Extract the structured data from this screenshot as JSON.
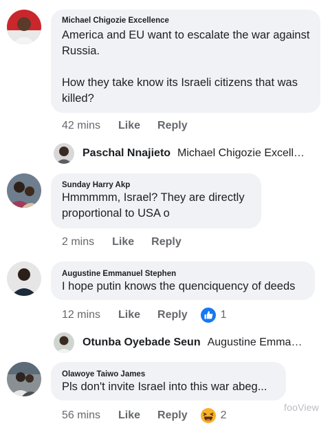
{
  "comments": [
    {
      "author": "Michael Chigozie Excellence",
      "text": "America and EU want to escalate the war against Russia.\n\nHow they take know its Israeli citizens that was killed?",
      "time": "42 mins",
      "like_label": "Like",
      "reply_label": "Reply",
      "reply": {
        "author": "Paschal Nnajieto",
        "preview": "Michael Chigozie Excellence"
      }
    },
    {
      "author": "Sunday Harry Akp",
      "text": "Hmmmmm, Israel? They are directly proportional to USA o",
      "time": "2 mins",
      "like_label": "Like",
      "reply_label": "Reply"
    },
    {
      "author": "Augustine Emmanuel Stephen",
      "text": "I hope putin knows the quenciquency of deeds",
      "time": "12 mins",
      "like_label": "Like",
      "reply_label": "Reply",
      "reaction": {
        "icon": "like-thumb-icon",
        "count": "1",
        "color": "#1877f2"
      },
      "reply": {
        "author": "Otunba Oyebade Seun",
        "preview": "Augustine Emmanuel Stephen"
      }
    },
    {
      "author": "Olawoye Taiwo James",
      "text": "Pls don't invite Israel into this war abeg...",
      "time": "56 mins",
      "like_label": "Like",
      "reply_label": "Reply",
      "reaction": {
        "icon": "haha-emoji-icon",
        "count": "2",
        "color": "#f7b125"
      }
    }
  ],
  "watermark": "fooView"
}
